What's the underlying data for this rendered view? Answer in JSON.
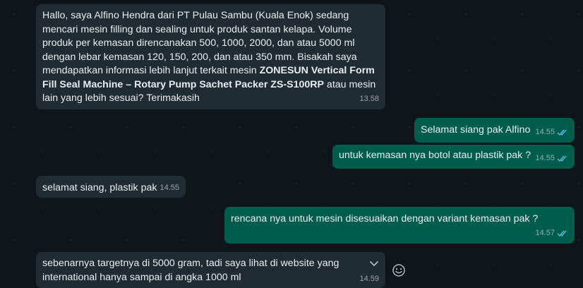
{
  "messages": [
    {
      "direction": "incoming",
      "parts": [
        {
          "text": "Hallo, saya Alfino Hendra dari PT Pulau Sambu (Kuala Enok) sedang mencari mesin filling dan sealing untuk produk santan kelapa. Volume produk per kemasan direncanakan 500, 1000, 2000, dan atau 5000 ml dengan lebar kemasan 120, 150, 200, dan atau 350 mm. Bisakah saya mendapatkan informasi lebih lanjut terkait mesin "
        },
        {
          "text": "ZONESUN Vertical Form Fill Seal Machine – Rotary Pump Sachet Packer ZS-S100RP",
          "bold": true
        },
        {
          "text": " atau mesin lain yang lebih sesuai? Terimakasih"
        }
      ],
      "time": "13.58"
    },
    {
      "direction": "outgoing",
      "text": "Selamat siang pak Alfino",
      "time": "14.55",
      "status": "read"
    },
    {
      "direction": "outgoing",
      "text": "untuk kemasan nya botol atau plastik pak ?",
      "time": "14.55",
      "status": "read"
    },
    {
      "direction": "incoming",
      "text": "selamat siang, plastik pak",
      "time": "14.55"
    },
    {
      "direction": "outgoing",
      "text": "rencana nya untuk mesin disesuaikan dengan variant kemasan pak ?",
      "time": "14.57",
      "status": "read"
    },
    {
      "direction": "incoming",
      "text": "sebenarnya targetnya di 5000 gram, tadi saya lihat di website yang international hanya sampai di angka 1000 ml",
      "time": "14.59"
    }
  ],
  "icons": {
    "menu": "chevron-down-icon",
    "react": "emoji-icon",
    "read": "double-check-icon"
  },
  "colors": {
    "incoming_bubble": "#202c33",
    "outgoing_bubble": "#005c4b",
    "read_tick": "#53bdeb",
    "background": "#0b141a"
  }
}
